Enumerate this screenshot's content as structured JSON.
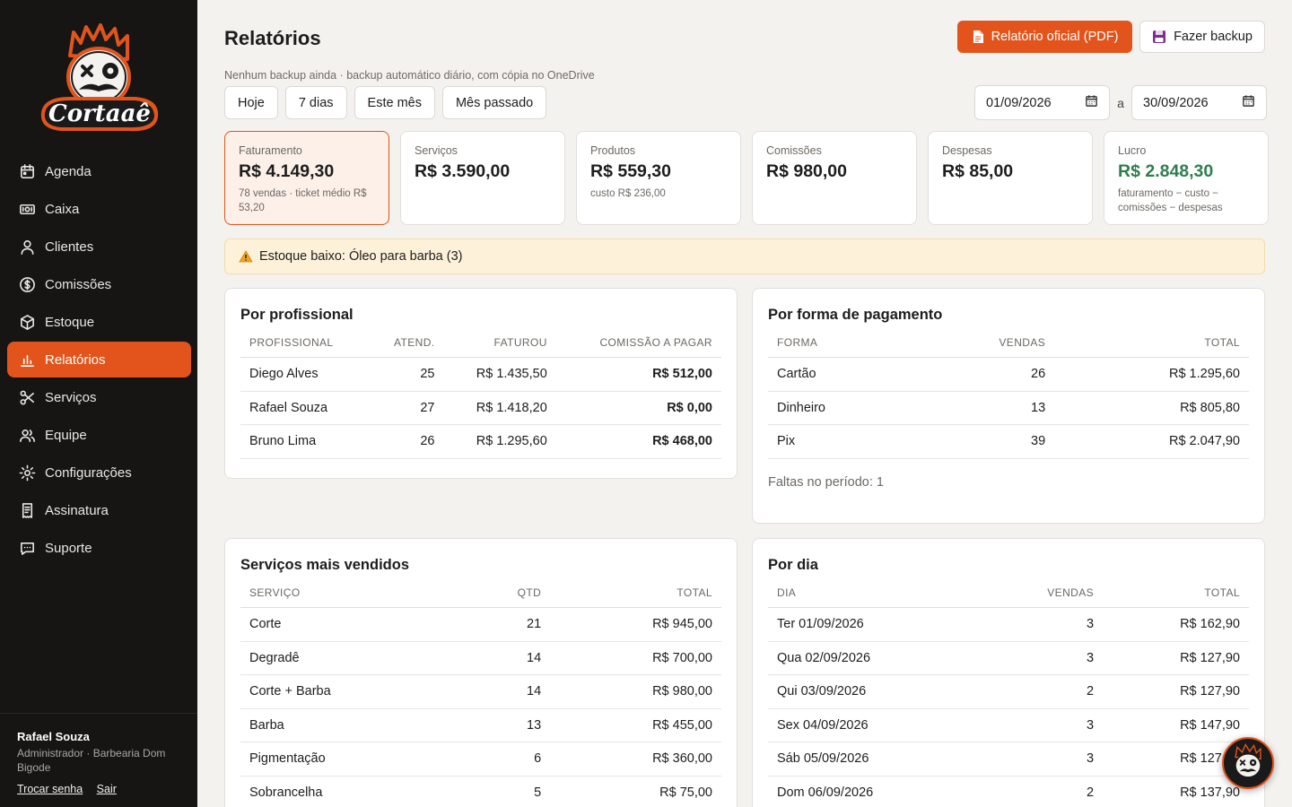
{
  "brand": {
    "name": "Cortaaê",
    "accent": "#e2541b"
  },
  "sidebar": {
    "items": [
      {
        "label": "Agenda",
        "icon": "calendar-icon"
      },
      {
        "label": "Caixa",
        "icon": "cash-register-icon"
      },
      {
        "label": "Clientes",
        "icon": "user-icon"
      },
      {
        "label": "Comissões",
        "icon": "dollar-circle-icon"
      },
      {
        "label": "Estoque",
        "icon": "box-icon"
      },
      {
        "label": "Relatórios",
        "icon": "bar-chart-icon",
        "active": true
      },
      {
        "label": "Serviços",
        "icon": "scissors-icon"
      },
      {
        "label": "Equipe",
        "icon": "users-icon"
      },
      {
        "label": "Configurações",
        "icon": "gear-icon"
      },
      {
        "label": "Assinatura",
        "icon": "receipt-icon"
      },
      {
        "label": "Suporte",
        "icon": "chat-icon"
      }
    ],
    "user": {
      "name": "Rafael Souza",
      "role": "Administrador · Barbearia Dom Bigode",
      "change_password": "Trocar senha",
      "logout": "Sair"
    }
  },
  "header": {
    "title": "Relatórios",
    "pdf_button": "Relatório oficial (PDF)",
    "backup_button": "Fazer backup",
    "backup_note": "Nenhum backup ainda · backup automático diário, com cópia no OneDrive"
  },
  "filters": {
    "quick": [
      "Hoje",
      "7 dias",
      "Este mês",
      "Mês passado"
    ],
    "date_from": "01/09/2026",
    "date_separator": "a",
    "date_to": "30/09/2026"
  },
  "kpis": [
    {
      "label": "Faturamento",
      "value": "R$ 4.149,30",
      "sub": "78 vendas · ticket médio R$ 53,20",
      "highlight": true
    },
    {
      "label": "Serviços",
      "value": "R$ 3.590,00",
      "sub": ""
    },
    {
      "label": "Produtos",
      "value": "R$ 559,30",
      "sub": "custo R$ 236,00"
    },
    {
      "label": "Comissões",
      "value": "R$ 980,00",
      "sub": ""
    },
    {
      "label": "Despesas",
      "value": "R$ 85,00",
      "sub": ""
    },
    {
      "label": "Lucro",
      "value": "R$ 2.848,30",
      "sub": "faturamento − custo − comissões − despesas",
      "color": "#2e7d4f"
    }
  ],
  "alert": {
    "text": "Estoque baixo: Óleo para barba (3)"
  },
  "por_profissional": {
    "title": "Por profissional",
    "columns": [
      "PROFISSIONAL",
      "ATEND.",
      "FATUROU",
      "COMISSÃO A PAGAR"
    ],
    "rows": [
      [
        "Diego Alves",
        "25",
        "R$ 1.435,50",
        "R$ 512,00"
      ],
      [
        "Rafael Souza",
        "27",
        "R$ 1.418,20",
        "R$ 0,00"
      ],
      [
        "Bruno Lima",
        "26",
        "R$ 1.295,60",
        "R$ 468,00"
      ]
    ]
  },
  "por_pagamento": {
    "title": "Por forma de pagamento",
    "columns": [
      "FORMA",
      "VENDAS",
      "TOTAL"
    ],
    "rows": [
      [
        "Cartão",
        "26",
        "R$ 1.295,60"
      ],
      [
        "Dinheiro",
        "13",
        "R$ 805,80"
      ],
      [
        "Pix",
        "39",
        "R$ 2.047,90"
      ]
    ],
    "note": "Faltas no período: 1"
  },
  "servicos": {
    "title": "Serviços mais vendidos",
    "columns": [
      "SERVIÇO",
      "QTD",
      "TOTAL"
    ],
    "rows": [
      [
        "Corte",
        "21",
        "R$ 945,00"
      ],
      [
        "Degradê",
        "14",
        "R$ 700,00"
      ],
      [
        "Corte + Barba",
        "14",
        "R$ 980,00"
      ],
      [
        "Barba",
        "13",
        "R$ 455,00"
      ],
      [
        "Pigmentação",
        "6",
        "R$ 360,00"
      ],
      [
        "Sobrancelha",
        "5",
        "R$ 75,00"
      ]
    ]
  },
  "por_dia": {
    "title": "Por dia",
    "columns": [
      "DIA",
      "VENDAS",
      "TOTAL"
    ],
    "rows": [
      [
        "Ter 01/09/2026",
        "3",
        "R$ 162,90"
      ],
      [
        "Qua 02/09/2026",
        "3",
        "R$ 127,90"
      ],
      [
        "Qui 03/09/2026",
        "2",
        "R$ 127,90"
      ],
      [
        "Sex 04/09/2026",
        "3",
        "R$ 147,90"
      ],
      [
        "Sáb 05/09/2026",
        "3",
        "R$ 127,90"
      ],
      [
        "Dom 06/09/2026",
        "2",
        "R$ 137,90"
      ]
    ]
  }
}
